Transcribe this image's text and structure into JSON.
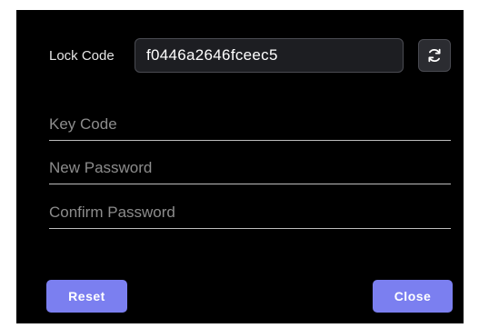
{
  "lock_code": {
    "label": "Lock Code",
    "value": "f0446a2646fceec5",
    "refresh_icon": "refresh-icon"
  },
  "fields": {
    "key_code_placeholder": "Key Code",
    "new_password_placeholder": "New Password",
    "confirm_password_placeholder": "Confirm Password"
  },
  "buttons": {
    "reset_label": "Reset",
    "close_label": "Close"
  },
  "colors": {
    "background": "#000000",
    "accent": "#7b7ff0",
    "field_underline": "#bdbdbd"
  }
}
